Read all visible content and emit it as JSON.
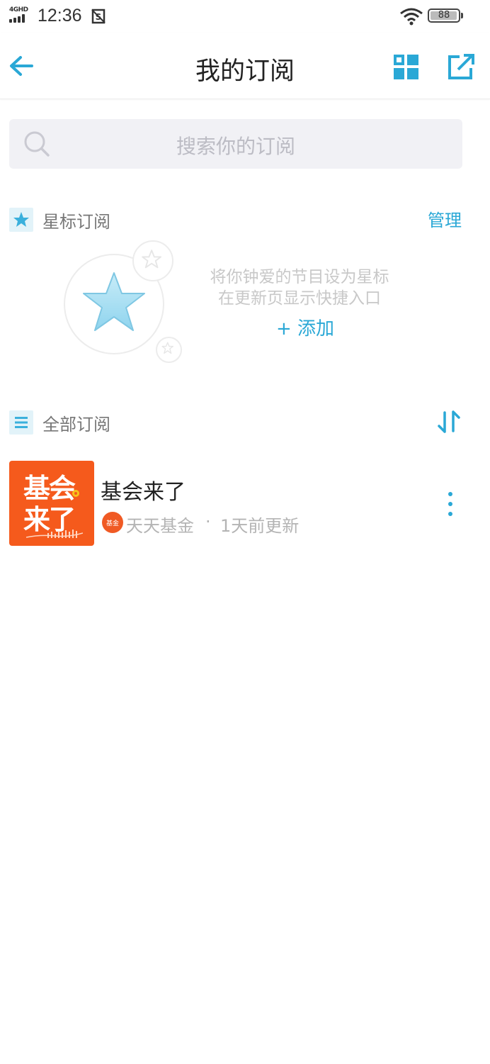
{
  "status_bar": {
    "network": "4GHD",
    "time": "12:36",
    "battery": "88"
  },
  "nav": {
    "title": "我的订阅"
  },
  "search": {
    "placeholder": "搜索你的订阅"
  },
  "starred": {
    "title": "星标订阅",
    "manage_label": "管理",
    "empty_line1": "将你钟爱的节目设为星标",
    "empty_line2": "在更新页显示快捷入口",
    "add_label": "+ 添加"
  },
  "all": {
    "title": "全部订阅",
    "items": [
      {
        "cover_line1": "基会",
        "cover_line2": "来了",
        "title": "基会来了",
        "avatar_text": "基金",
        "author": "天天基金",
        "separator": "·",
        "updated": "1天前更新"
      }
    ]
  },
  "colors": {
    "accent": "#2aa8d6",
    "cover_bg": "#f55a1c",
    "muted_text": "#b4b4b4"
  },
  "icons": {
    "back": "arrow-left-icon",
    "grid": "grid-icon",
    "share": "share-icon",
    "search": "search-icon",
    "star": "star-icon",
    "list": "list-icon",
    "sort": "sort-icon",
    "more": "more-vertical-icon"
  }
}
